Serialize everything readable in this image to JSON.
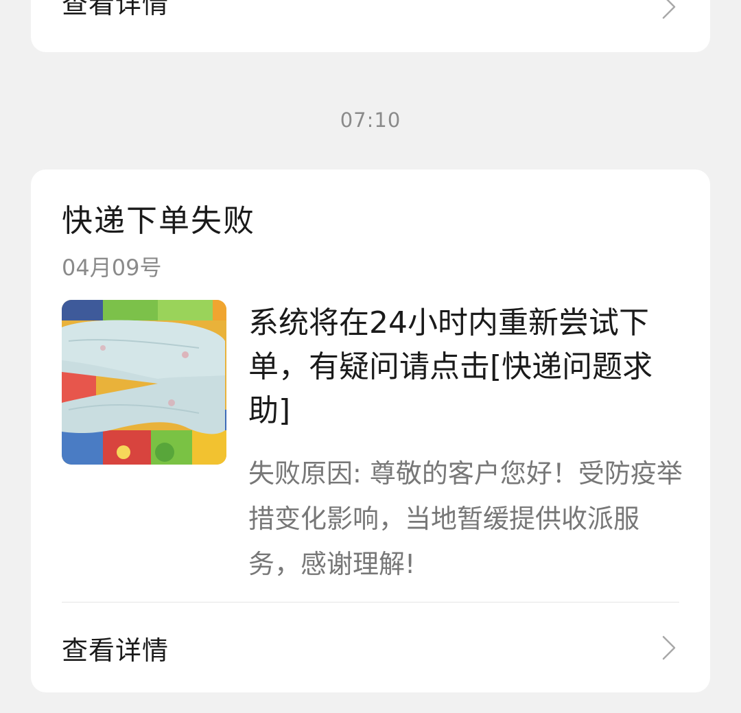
{
  "top_card": {
    "details_label": "查看详情"
  },
  "timestamp": "07:10",
  "notification": {
    "title": "快递下单失败",
    "date": "04月09号",
    "thumbnail": "baby-pants-photo",
    "headline": "系统将在24小时内重新尝试下单，有疑问请点击[快递问题求助]",
    "reason": "失败原因: 尊敬的客户您好！受防疫举措变化影响，当地暂缓提供收派服务，感谢理解!",
    "details_label": "查看详情"
  },
  "icons": {
    "chevron": "chevron-right-icon"
  },
  "colors": {
    "background": "#f1f1f1",
    "card": "#ffffff",
    "primary_text": "#1a1a1a",
    "secondary_text": "#8a8a8a",
    "body_muted_text": "#777777"
  }
}
